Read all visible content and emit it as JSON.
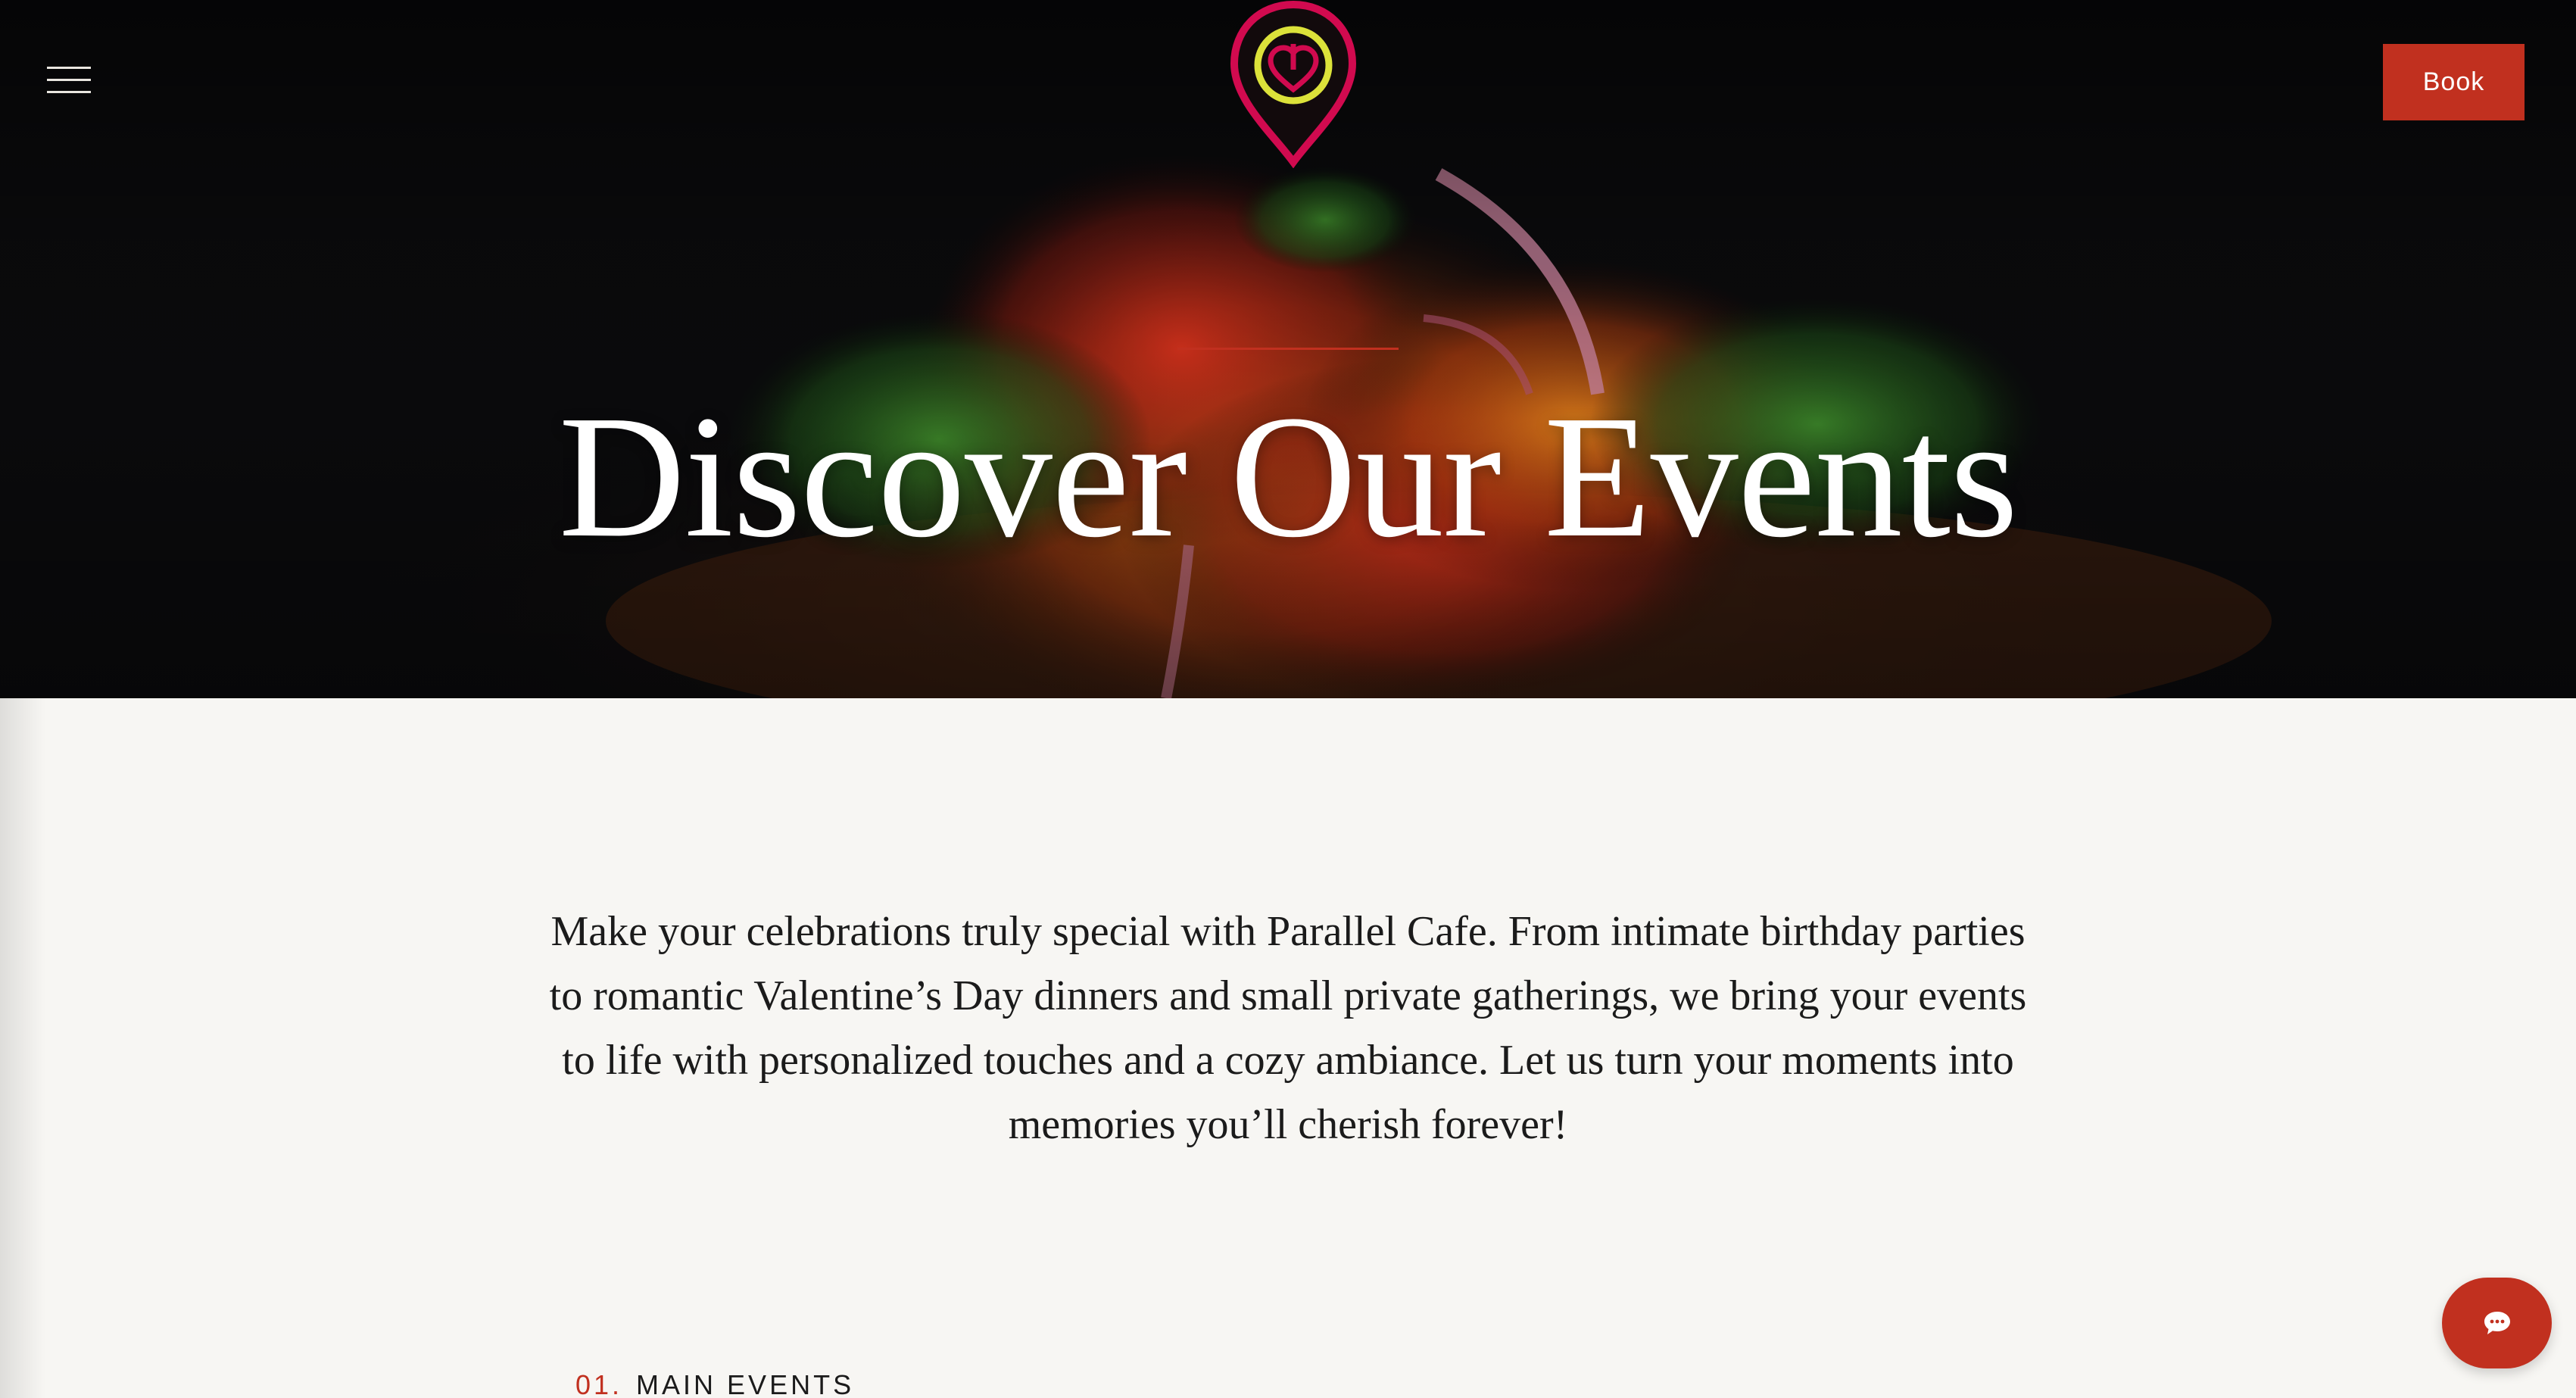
{
  "header": {
    "menu_icon": "hamburger-menu-icon",
    "logo_icon": "map-pin-heart-logo",
    "book_label": "Book"
  },
  "hero": {
    "title": "Discover Our Events",
    "background": "salad-photo-dark"
  },
  "intro": {
    "text": "Make your celebrations truly special with Parallel Cafe. From intimate birthday parties to romantic Valentine’s Day dinners and small private gatherings, we bring your events to life with personalized touches and a cozy ambiance. Let us turn your moments into memories you’ll cherish forever!"
  },
  "section": {
    "number": "01.",
    "label": "MAIN EVENTS"
  },
  "chat": {
    "icon": "chat-bubble-icon"
  },
  "colors": {
    "accent": "#c1301f",
    "logo_pin": "#d10a4f",
    "logo_ring": "#dce23a",
    "page_bg": "#f7f6f3",
    "text": "#1b1b1b"
  }
}
